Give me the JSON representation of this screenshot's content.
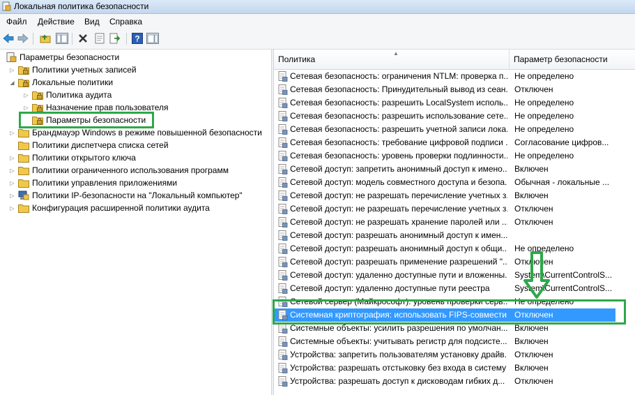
{
  "window": {
    "title": "Локальная политика безопасности"
  },
  "menu": [
    "Файл",
    "Действие",
    "Вид",
    "Справка"
  ],
  "toolbar": {
    "buttons": [
      "back-icon",
      "forward-icon",
      "up-folder-icon",
      "show-hide-tree-icon",
      "delete-icon",
      "properties-icon",
      "export-icon",
      "help-icon",
      "action-pane-icon"
    ]
  },
  "tree": [
    {
      "label": "Параметры безопасности",
      "level": 0,
      "expander": "",
      "icon": "security-settings-icon"
    },
    {
      "label": "Политики учетных записей",
      "level": 1,
      "expander": "▷",
      "icon": "folder-lock-icon"
    },
    {
      "label": "Локальные политики",
      "level": 1,
      "expander": "◢",
      "icon": "folder-lock-icon"
    },
    {
      "label": "Политика аудита",
      "level": 2,
      "expander": "▷",
      "icon": "folder-lock-icon"
    },
    {
      "label": "Назначение прав пользователя",
      "level": 2,
      "expander": "▷",
      "icon": "folder-lock-icon"
    },
    {
      "label": "Параметры безопасности",
      "level": 2,
      "expander": "",
      "icon": "folder-lock-icon",
      "highlighted": true
    },
    {
      "label": "Брандмауэр Windows в режиме повышенной безопасности",
      "level": 1,
      "expander": "▷",
      "icon": "folder-icon"
    },
    {
      "label": "Политики диспетчера списка сетей",
      "level": 1,
      "expander": "",
      "icon": "folder-icon"
    },
    {
      "label": "Политики открытого ключа",
      "level": 1,
      "expander": "▷",
      "icon": "folder-icon"
    },
    {
      "label": "Политики ограниченного использования программ",
      "level": 1,
      "expander": "▷",
      "icon": "folder-icon"
    },
    {
      "label": "Политики управления приложениями",
      "level": 1,
      "expander": "▷",
      "icon": "folder-icon"
    },
    {
      "label": "Политики IP-безопасности на \"Локальный компьютер\"",
      "level": 1,
      "expander": "▷",
      "icon": "ip-security-icon"
    },
    {
      "label": "Конфигурация расширенной политики аудита",
      "level": 1,
      "expander": "▷",
      "icon": "folder-icon"
    }
  ],
  "list": {
    "columns": [
      "Политика",
      "Параметр безопасности"
    ],
    "rows": [
      {
        "policy": "Сетевая безопасность: ограничения NTLM: проверка п...",
        "value": "Не определено"
      },
      {
        "policy": "Сетевая безопасность: Принудительный вывод из сеан...",
        "value": "Отключен"
      },
      {
        "policy": "Сетевая безопасность: разрешить LocalSystem исполь...",
        "value": "Не определено"
      },
      {
        "policy": "Сетевая безопасность: разрешить использование сете...",
        "value": "Не определено"
      },
      {
        "policy": "Сетевая безопасность: разрешить учетной записи лока...",
        "value": "Не определено"
      },
      {
        "policy": "Сетевая безопасность: требование цифровой подписи ...",
        "value": "Согласование цифров..."
      },
      {
        "policy": "Сетевая безопасность: уровень проверки подлинности...",
        "value": "Не определено"
      },
      {
        "policy": "Сетевой доступ: запретить анонимный доступ к имено...",
        "value": "Включен"
      },
      {
        "policy": "Сетевой доступ: модель совместного доступа и безопа...",
        "value": "Обычная - локальные ..."
      },
      {
        "policy": "Сетевой доступ: не разрешать перечисление учетных з...",
        "value": "Включен"
      },
      {
        "policy": "Сетевой доступ: не разрешать перечисление учетных з...",
        "value": "Отключен"
      },
      {
        "policy": "Сетевой доступ: не разрешать хранение паролей или ...",
        "value": "Отключен"
      },
      {
        "policy": "Сетевой доступ: разрешать анонимный доступ к имен...",
        "value": ""
      },
      {
        "policy": "Сетевой доступ: разрешать анонимный доступ к общи...",
        "value": "Не определено"
      },
      {
        "policy": "Сетевой доступ: разрешать применение разрешений \"...",
        "value": "Отключен"
      },
      {
        "policy": "Сетевой доступ: удаленно доступные пути и вложенны...",
        "value": "System\\CurrentControlS..."
      },
      {
        "policy": "Сетевой доступ: удаленно доступные пути реестра",
        "value": "System\\CurrentControlS..."
      },
      {
        "policy": "Сетевой сервер (Майкрософт): уровень проверки серв...",
        "value": "Не определено"
      },
      {
        "policy": "Системная криптография: использовать FIPS-совмести...",
        "value": "Отключен",
        "selected": true
      },
      {
        "policy": "Системные объекты: усилить разрешения по умолчан...",
        "value": "Включен"
      },
      {
        "policy": "Системные объекты: учитывать регистр для подсисте...",
        "value": "Включен"
      },
      {
        "policy": "Устройства: запретить пользователям установку драйв...",
        "value": "Отключен"
      },
      {
        "policy": "Устройства: разрешать отстыковку без входа в систему",
        "value": "Включен"
      },
      {
        "policy": "Устройства: разрешать доступ к дисководам гибких д...",
        "value": "Отключен"
      }
    ]
  },
  "colors": {
    "selection": "#3399ff",
    "annotation": "#2ea84a"
  }
}
